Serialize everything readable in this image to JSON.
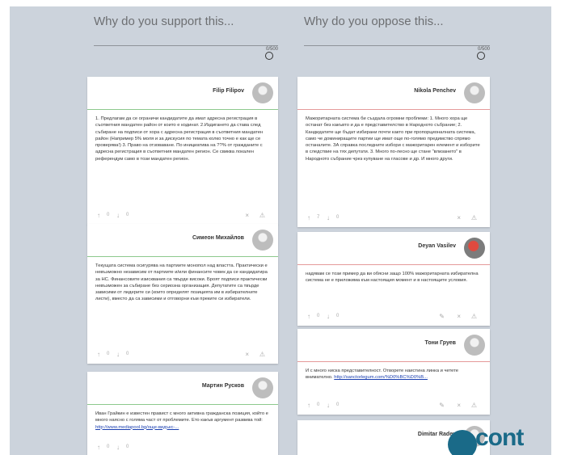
{
  "support": {
    "prompt": "Why do you support this...",
    "counter": "0/500",
    "cards": [
      {
        "name": "Filip Filipov",
        "text": "1. Предлагам да се ограничи кандидатите да имат адресна регистрация в съответния мандатен район от които е кодинат. 2.Издигането да става след събиране на подписи от хора с адресна регистрация в съответния мандатен район (Например 5% моля и за дискусия по темата колко точно е как ще се проверява!) 3. Право на отзоваване. По инициатива на ??% от гражданите с адресна регистрация в съответния мандатен регион. Се свиква локален референдум само в този мандатен регион.",
        "up": "0",
        "down": "0"
      },
      {
        "name": "Симеон Михайлов",
        "text": "Текущата система осигурява на партиите монопол над властта. Практически е невъзможно независим от партиите и/или финансите човек да се кандидатира за НС. Финансовите изисквания са твърде високи. Броят подписи практически невъзможен за събиране без сериозна организация. Депутатите са твърде зависими от лидерите си (които определят позицията им в избирателните листи), вместо да са зависими и отговорни към преките си избиратели.",
        "up": "0",
        "down": "0"
      },
      {
        "name": "Мартин Русков",
        "text": "Иван Грайкин е известен правист с много активна гражданска позиция, който е много наясно с голяма част от проблемите. Ето какъв аргумент развива той:",
        "link": "http://www.mediapool.bg/още-видъкс-...",
        "up": "0",
        "down": "0"
      }
    ]
  },
  "oppose": {
    "prompt": "Why do you oppose this...",
    "counter": "0/500",
    "cards": [
      {
        "name": "Nikola Penchev",
        "text": "Мажоритарната система би създала огромни проблеми: 1. Много хора ще останат без какъвто и да е представителство в Народното събрание; 2. Кандидатите ще бъдат избирани почти както при пропорционалната система, само че доминиращите партии ще имат още по-голямо предимство спрямо останалите. ЗА справка последните избори с мажоритарен елемент и изборите в следствие на тях депутати. 3. Много по-лесно ще стане \"влизането\" в Народното събрание чрез купуване на гласове и др. И много други.",
        "up": "7",
        "down": "0"
      },
      {
        "name": "Deyan Vasilev",
        "text": "надявам се този пример да ви обясни защо 100% мажоритарната избирателна система не е приложима към настоящия момент и в настоящите условия.",
        "up": "0",
        "down": "0"
      },
      {
        "name": "Тони Груев",
        "text": "И с много ниска представителност. Отворете наистина линка и четете внимателно.",
        "link": "http://sanctorlegum.com/%D0%BC%D0%B...",
        "up": "0",
        "down": "0"
      },
      {
        "name": "Dimitar Radev",
        "text": ""
      }
    ]
  },
  "logo": {
    "text": "cont"
  },
  "icons": {
    "up": "↑",
    "down": "↓",
    "close": "×",
    "flag": "⚠",
    "edit": "✎"
  }
}
